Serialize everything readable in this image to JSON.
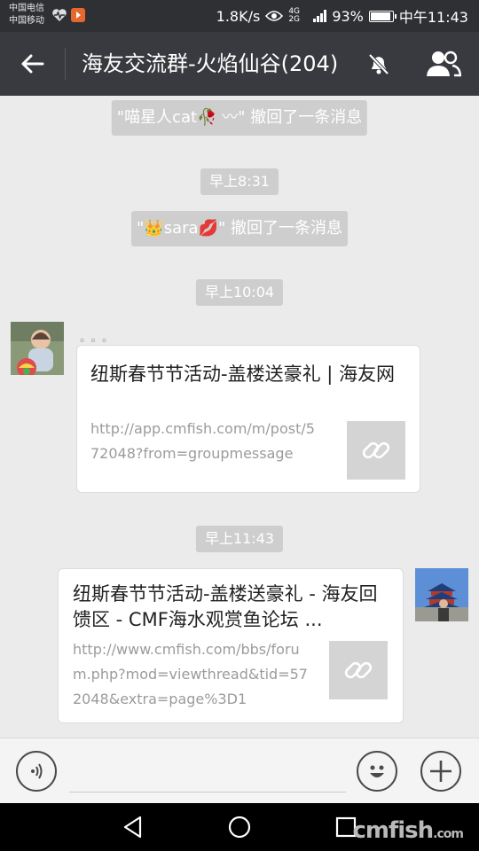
{
  "status_bar": {
    "carrier1": "中国电信",
    "carrier2": "中国移动",
    "speed": "1.8K/s",
    "network": "4G 2G",
    "battery": "93%",
    "time": "中午11:43"
  },
  "header": {
    "title": "海友交流群-火焰仙谷(204)",
    "back_icon": "arrow-left-icon",
    "mute_icon": "bell-off-icon",
    "members_icon": "group-icon"
  },
  "messages": {
    "recall1": "\"喵星人cat🥀 〰\" 撤回了一条消息",
    "time1": "早上8:31",
    "recall2": "\"👑sara💋\" 撤回了一条消息",
    "time2": "早上10:04",
    "sender_name": "。。。",
    "card1": {
      "title": "纽斯春节节活动-盖楼送豪礼 | 海友网",
      "url": "http://app.cmfish.com/m/post/572048?from=groupmessage"
    },
    "time3": "早上11:43",
    "card2": {
      "title": "纽斯春节节活动-盖楼送豪礼 - 海友回馈区 - CMF海水观赏鱼论坛 ...",
      "url": "http://www.cmfish.com/bbs/forum.php?mod=viewthread&tid=572048&extra=page%3D1"
    }
  },
  "input_bar": {
    "voice_icon": "voice-icon",
    "emoji_icon": "emoji-icon",
    "add_icon": "plus-icon"
  },
  "watermark": {
    "main": "cmfish",
    "suffix": ".com"
  },
  "colors": {
    "titlebar": "#393a3f",
    "statusbar": "#2f3034",
    "chat_bg": "#ebebeb",
    "system_pill": "#cecece"
  }
}
